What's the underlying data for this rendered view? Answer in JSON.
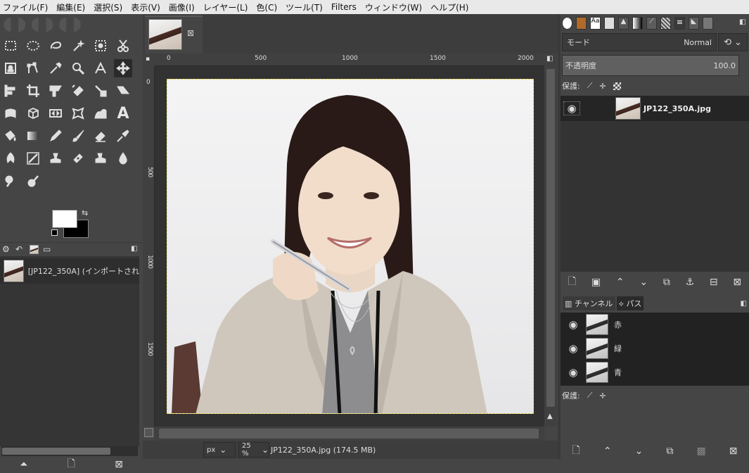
{
  "menu": [
    "ファイル(F)",
    "編集(E)",
    "選択(S)",
    "表示(V)",
    "画像(I)",
    "レイヤー(L)",
    "色(C)",
    "ツール(T)",
    "Filters",
    "ウィンドウ(W)",
    "ヘルプ(H)"
  ],
  "images_panel": {
    "item_label": "[JP122_350A] (インポートされ"
  },
  "rulers": {
    "h": [
      "0",
      "500",
      "1000",
      "1500",
      "2000"
    ],
    "v": [
      "0",
      "500",
      "1000",
      "1500"
    ]
  },
  "status": {
    "unit": "px",
    "zoom": "25 %",
    "file_info": "JP122_350A.jpg (174.5 MB)"
  },
  "layers": {
    "mode_label": "モード",
    "mode_value": "Normal",
    "opacity_label": "不透明度",
    "opacity_value": "100.0",
    "lock_label": "保護:",
    "layer_name": "JP122_350A.jpg"
  },
  "channels": {
    "tab_channels": "チャンネル",
    "tab_paths": "パス",
    "items": [
      "赤",
      "緑",
      "青"
    ],
    "lock_label": "保護:"
  },
  "colors": {
    "accent": "#e8d84a",
    "fg": "#ffffff",
    "bg": "#000000"
  }
}
